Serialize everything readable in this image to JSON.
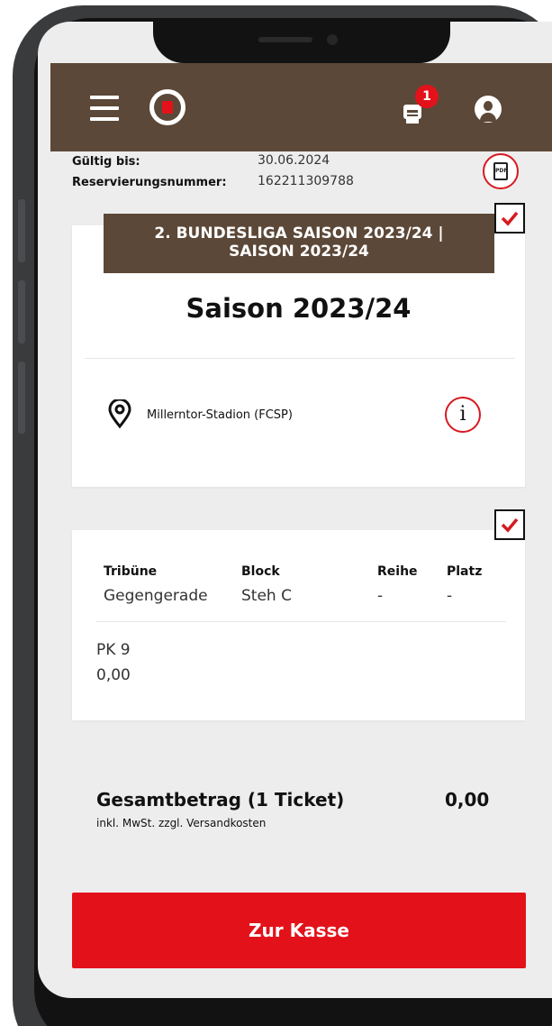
{
  "header": {
    "cart_badge_count": "1",
    "icons": [
      "menu-icon",
      "club-logo",
      "cart-icon",
      "user-icon"
    ]
  },
  "reservation": {
    "valid_until_label": "Gültig bis:",
    "valid_until_value": "30.06.2024",
    "reservation_number_label": "Reservierungsnummer:",
    "reservation_number_value": "162211309788",
    "pdf_label": "PDF"
  },
  "event": {
    "banner_line1": "2. BUNDESLIGA SAISON 2023/24 |",
    "banner_line2": "SAISON 2023/24",
    "title": "Saison 2023/24",
    "venue": "Millerntor-Stadion (FCSP)",
    "info_symbol": "i"
  },
  "seat": {
    "columns": [
      {
        "header": "Tribüne",
        "value": "Gegengerade"
      },
      {
        "header": "Block",
        "value": "Steh C"
      },
      {
        "header": "Reihe",
        "value": "-"
      },
      {
        "header": "Platz",
        "value": "-"
      }
    ],
    "price_category": "PK 9",
    "price": "0,00"
  },
  "total": {
    "label": "Gesamtbetrag (1 Ticket)",
    "sublabel": "inkl. MwSt. zzgl. Versandkosten",
    "value": "0,00"
  },
  "checkout": {
    "label": "Zur Kasse"
  },
  "colors": {
    "brand_brown": "#5c4838",
    "accent_red": "#e3121a"
  }
}
